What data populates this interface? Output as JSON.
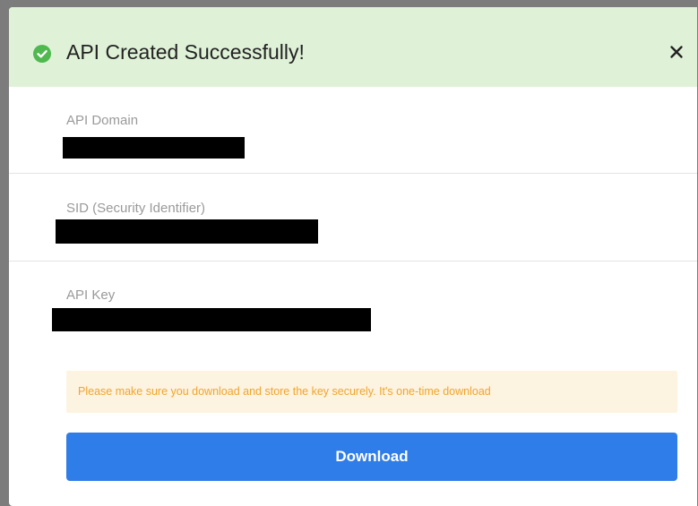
{
  "header": {
    "title": "API Created Successfully!",
    "status_icon": "check-circle-icon",
    "close_icon": "close-icon",
    "background": "#dff2d8"
  },
  "fields": [
    {
      "label": "API Domain",
      "value": "[redacted]"
    },
    {
      "label": "SID (Security Identifier)",
      "value": "[redacted]"
    },
    {
      "label": "API Key",
      "value": "[redacted]"
    }
  ],
  "notice": {
    "text": "Please make sure you download and store the key securely. It's one-time download",
    "color": "#f0a52a",
    "background": "#fdf3e1"
  },
  "download_button": {
    "label": "Download",
    "color": "#2f7de8"
  }
}
